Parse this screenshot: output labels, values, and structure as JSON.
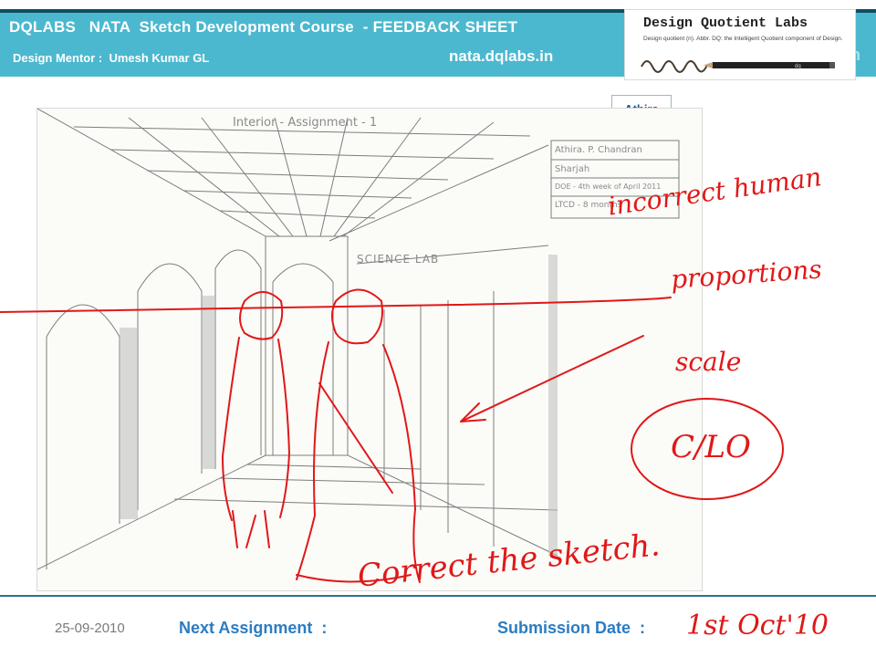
{
  "header": {
    "title": "DQLABS   NATA  Sketch Development Course  - FEEDBACK SHEET",
    "mentor": "Design Mentor :  Umesh Kumar GL",
    "url": "nata.dqlabs.in",
    "side_letter": "n"
  },
  "logo": {
    "title": "Design Quotient Labs",
    "tagline": "Design quotient (n). Abbr. DQ: the Intelligent Quotient component of Design.",
    "pencil_label": "dq"
  },
  "student_name": "Athira",
  "sketch": {
    "heading": "Interior - Assignment - 1",
    "sign_sign": "SCIENCE LAB",
    "info_lines": [
      "Athira. P. Chandran",
      "Sharjah",
      "DOE - 4th week of April 2011",
      "LTCD - 8 months"
    ]
  },
  "feedback": {
    "line1": "incorrect human",
    "line2": "proportions",
    "line3": "scale",
    "score": "C/LO",
    "next_action": "Correct the sketch.",
    "due": "1st  Oct'10"
  },
  "footer": {
    "date": "25-09-2010",
    "next_label": "Next Assignment  :",
    "submission_label": "Submission Date  :"
  },
  "colors": {
    "banner": "#4bb8cf",
    "ink": "#e01818",
    "label_blue": "#2b7cc2"
  }
}
